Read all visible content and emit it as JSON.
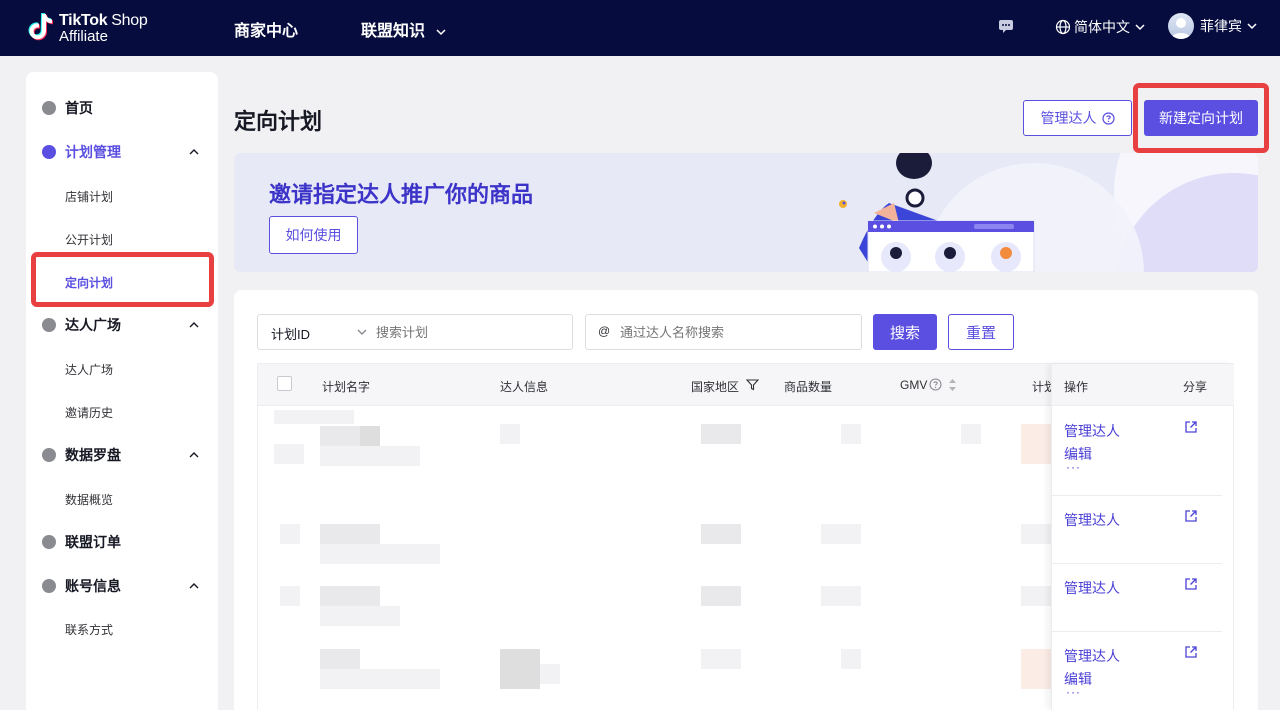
{
  "topnav": {
    "logo_line1_bold": "TikTok",
    "logo_line1_rest": "Shop",
    "logo_line2": "Affiliate",
    "links": [
      "商家中心",
      "联盟知识"
    ],
    "language": "简体中文",
    "user_name": "菲律宾",
    "colors": {
      "bg": "#060c3d"
    }
  },
  "sidebar": {
    "groups": [
      {
        "label": "首页",
        "items": []
      },
      {
        "label": "计划管理",
        "items": [
          "店铺计划",
          "公开计划",
          "定向计划"
        ]
      },
      {
        "label": "达人广场",
        "items": [
          "达人广场",
          "邀请历史"
        ]
      },
      {
        "label": "数据罗盘",
        "items": [
          "数据概览"
        ]
      },
      {
        "label": "联盟订单",
        "items": []
      },
      {
        "label": "账号信息",
        "items": [
          "联系方式"
        ]
      }
    ],
    "active_item": "定向计划"
  },
  "main": {
    "title": "定向计划",
    "manage_creators_btn": "管理达人",
    "new_plan_btn": "新建定向计划",
    "banner": {
      "title": "邀请指定达人推广你的商品",
      "how_to_btn": "如何使用"
    },
    "filters": {
      "select_value": "计划ID",
      "search_placeholder": "搜索计划",
      "at_symbol": "@",
      "creator_placeholder": "通过达人名称搜索",
      "search_btn": "搜索",
      "reset_btn": "重置"
    },
    "table": {
      "columns": [
        "计划名字",
        "达人信息",
        "国家地区",
        "商品数量",
        "GMV",
        "计划"
      ],
      "ops_header": "操作",
      "share_header": "分享",
      "rows": [
        {
          "actions": [
            "管理达人",
            "编辑"
          ],
          "more": "···"
        },
        {
          "actions": [
            "管理达人"
          ],
          "more": ""
        },
        {
          "actions": [
            "管理达人"
          ],
          "more": ""
        },
        {
          "actions": [
            "管理达人",
            "编辑"
          ],
          "more": "···"
        }
      ]
    }
  },
  "colors": {
    "accent": "#5a4fe0",
    "highlight": "#e84040"
  }
}
